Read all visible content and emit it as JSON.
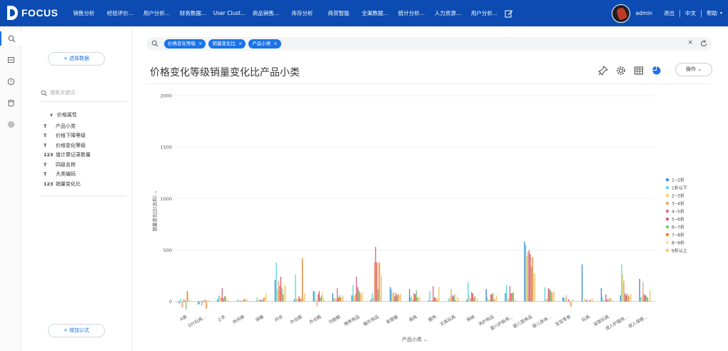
{
  "brand": "FOCUS",
  "nav": [
    "销售分析",
    "经验评价...",
    "用户分析...",
    "财务数据...",
    "User Clust...",
    "商品销售...",
    "库存分析",
    "商贸智能",
    "全渠数据...",
    "统计分析...",
    "人力资源...",
    "用户分析..."
  ],
  "user": {
    "name": "admin",
    "logout": "退出",
    "lang": "中文",
    "help": "帮助"
  },
  "fieldpanel": {
    "select_data": "选择数据",
    "search_placeholder": "搜索关键词",
    "group": "价格属性",
    "fields": [
      {
        "type": "T",
        "name": "产品小类"
      },
      {
        "type": "T",
        "name": "价格下降等级"
      },
      {
        "type": "T",
        "name": "价格变化等级"
      },
      {
        "type": "123",
        "name": "值计算记录数量"
      },
      {
        "type": "T",
        "name": "四级名称"
      },
      {
        "type": "T",
        "name": "大类编码"
      },
      {
        "type": "123",
        "name": "销量变化比"
      }
    ],
    "add_formula": "增加公式"
  },
  "filters": [
    "价格变化等级",
    "销量变化比",
    "产品小类"
  ],
  "title": "价格变化等级销量变化比产品小类",
  "operate": "操作",
  "colors": {
    "brand": "#0b4bb2",
    "accent": "#1a73e8",
    "series": [
      "#3a8edb",
      "#5dd6d8",
      "#f5cf5c",
      "#f0a07a",
      "#d96b88",
      "#e05a5a",
      "#7bc67e",
      "#ee7f2d",
      "#f6e2a6",
      "#f3c572"
    ]
  },
  "chart_data": {
    "type": "bar",
    "xlabel": "产品小类",
    "ylabel": "销量变化比(总和)",
    "ylim": [
      -100,
      2000
    ],
    "yticks": [
      0,
      500,
      1000,
      1500,
      2000
    ],
    "legend_position": "right",
    "categories": [
      "A类",
      "DIY玩具...",
      "上衣",
      "休闲裤",
      "保暖",
      "内衣",
      "外出服",
      "外出鞋",
      "功能鞋",
      "喂养用品",
      "婚庆用品",
      "家居服",
      "寝具",
      "服饰",
      "文具玩具",
      "棉袜",
      "洗护用品",
      "婴儿护肤用...",
      "婴儿营养品",
      "婴儿身体...",
      "宝宝零食",
      "玩具",
      "益智玩具",
      "成人护理用...",
      "成人保健..."
    ],
    "series": [
      {
        "name": "1--2折",
        "values": [
          -20,
          -30,
          20,
          0,
          0,
          210,
          20,
          100,
          80,
          60,
          20,
          140,
          120,
          10,
          0,
          20,
          120,
          80,
          580,
          0,
          40,
          360,
          130,
          60,
          220
        ]
      },
      {
        "name": "1折以下",
        "values": [
          30,
          -25,
          60,
          20,
          40,
          380,
          260,
          100,
          30,
          160,
          80,
          120,
          40,
          100,
          30,
          190,
          40,
          160,
          550,
          140,
          40,
          0,
          40,
          360,
          40
        ]
      },
      {
        "name": "2--3折",
        "values": [
          -50,
          10,
          50,
          10,
          10,
          120,
          30,
          30,
          40,
          50,
          40,
          80,
          60,
          10,
          40,
          60,
          20,
          20,
          440,
          30,
          20,
          30,
          10,
          260,
          50
        ]
      },
      {
        "name": "3--4折",
        "values": [
          -60,
          -40,
          40,
          10,
          20,
          200,
          20,
          -50,
          20,
          70,
          380,
          90,
          20,
          10,
          120,
          30,
          10,
          30,
          480,
          20,
          60,
          10,
          10,
          200,
          190
        ]
      },
      {
        "name": "4--5折",
        "values": [
          20,
          -10,
          130,
          5,
          20,
          150,
          50,
          70,
          130,
          240,
          530,
          50,
          80,
          150,
          60,
          90,
          70,
          150,
          500,
          130,
          0,
          20,
          70,
          80,
          70
        ]
      },
      {
        "name": "5--6折",
        "values": [
          10,
          10,
          30,
          0,
          10,
          240,
          30,
          100,
          40,
          140,
          380,
          80,
          70,
          40,
          50,
          80,
          70,
          80,
          460,
          120,
          20,
          0,
          20,
          60,
          60
        ]
      },
      {
        "name": "6--7折",
        "values": [
          -80,
          20,
          50,
          20,
          20,
          130,
          20,
          40,
          60,
          110,
          120,
          60,
          110,
          40,
          70,
          40,
          80,
          80,
          340,
          110,
          0,
          0,
          10,
          80,
          50
        ]
      },
      {
        "name": "7--8折",
        "values": [
          100,
          -70,
          50,
          20,
          40,
          70,
          420,
          60,
          40,
          90,
          380,
          70,
          40,
          20,
          10,
          50,
          20,
          90,
          430,
          90,
          -50,
          20,
          30,
          50,
          40
        ]
      },
      {
        "name": "8--9折",
        "values": [
          80,
          20,
          10,
          30,
          50,
          170,
          40,
          100,
          50,
          70,
          370,
          50,
          50,
          40,
          60,
          10,
          40,
          10,
          280,
          80,
          20,
          10,
          40,
          70,
          20
        ]
      },
      {
        "name": "9折以上",
        "values": [
          20,
          10,
          20,
          20,
          80,
          150,
          80,
          30,
          60,
          90,
          250,
          80,
          40,
          140,
          40,
          30,
          60,
          20,
          270,
          100,
          20,
          30,
          30,
          70,
          110
        ]
      }
    ]
  }
}
